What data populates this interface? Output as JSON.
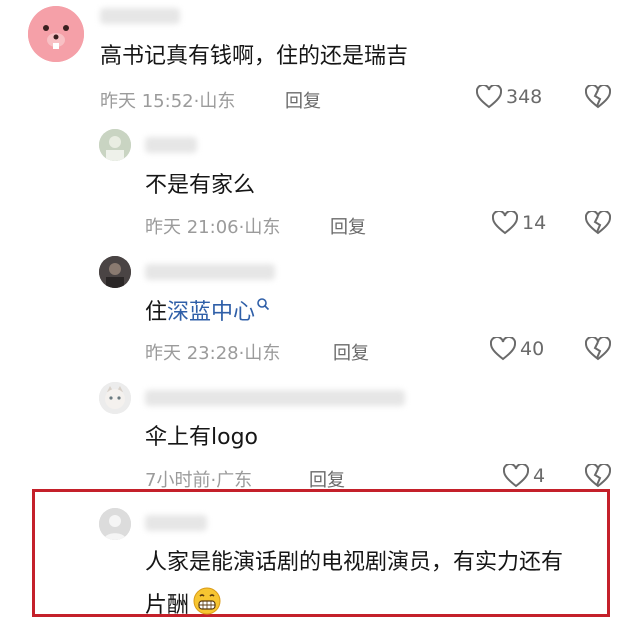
{
  "comments": [
    {
      "text": "高书记真有钱啊，住的还是瑞吉",
      "time": "昨天 15:52",
      "location": "山东",
      "reply_label": "回复",
      "likes": "348"
    },
    {
      "text": "不是有家么",
      "time": "昨天 21:06",
      "location": "山东",
      "reply_label": "回复",
      "likes": "14"
    },
    {
      "text_prefix": "住",
      "text_link": "深蓝中心",
      "time": "昨天 23:28",
      "location": "山东",
      "reply_label": "回复",
      "likes": "40"
    },
    {
      "text": "伞上有logo",
      "time": "7小时前",
      "location": "广东",
      "reply_label": "回复",
      "likes": "4"
    },
    {
      "text_line1": "人家是能演话剧的电视剧演员，有实力还有",
      "text_line2": "片酬"
    }
  ],
  "meta_separator": "·",
  "colors": {
    "highlight": "#c4202a",
    "link": "#2f5fa8",
    "avatar_pink": "#f5a0a8"
  },
  "icons": [
    "heart-icon",
    "broken-heart-icon",
    "search-icon",
    "grin-emoji-icon"
  ]
}
